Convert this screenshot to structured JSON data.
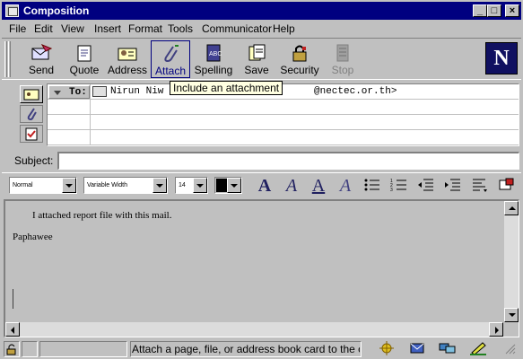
{
  "window": {
    "title": "Composition"
  },
  "menu": [
    "File",
    "Edit",
    "View",
    "Insert",
    "Format",
    "Tools",
    "Communicator",
    "Help"
  ],
  "toolbar": {
    "buttons": [
      {
        "label": "Send",
        "icon": "send-icon"
      },
      {
        "label": "Quote",
        "icon": "quote-icon"
      },
      {
        "label": "Address",
        "icon": "address-icon"
      },
      {
        "label": "Attach",
        "icon": "attach-icon",
        "state": "active"
      },
      {
        "label": "Spelling",
        "icon": "spelling-icon"
      },
      {
        "label": "Save",
        "icon": "save-icon"
      },
      {
        "label": "Security",
        "icon": "security-icon"
      },
      {
        "label": "Stop",
        "icon": "stop-icon",
        "state": "disabled"
      }
    ],
    "logo": "N"
  },
  "tooltip": "Include an attachment",
  "addressing": {
    "type_label": "To:",
    "recipient": "Nirun Niwatwutt ... nectec@nectec.or.th>",
    "recipient_visible_left": "Nirun Niw",
    "recipient_visible_right": "@nectec.or.th>"
  },
  "subject": {
    "label": "Subject:",
    "value": ""
  },
  "format": {
    "paragraph_style": "Normal",
    "font": "Variable Width",
    "size": "14",
    "color": "#000000"
  },
  "body": {
    "line1": "I attached report file with this mail.",
    "line2": "Paphawee"
  },
  "status": {
    "text": "Attach a page, file, or address book card to the curren"
  }
}
